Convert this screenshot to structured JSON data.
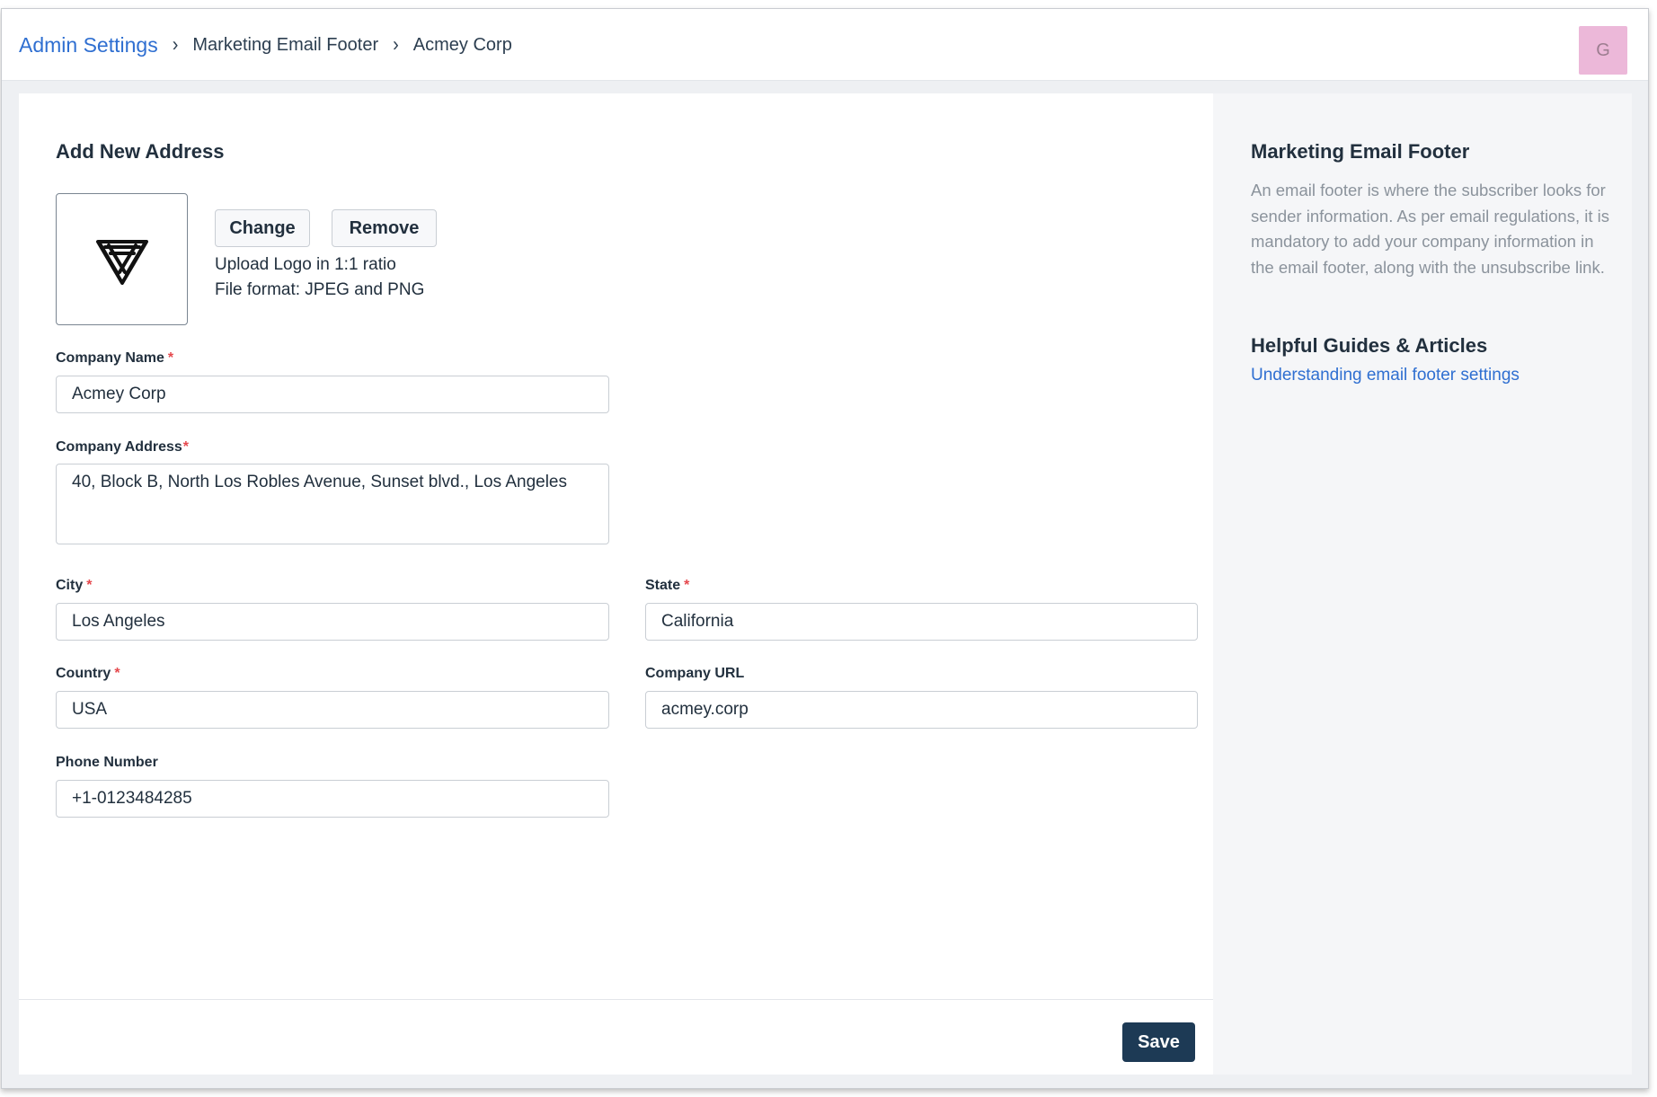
{
  "breadcrumb": {
    "root": "Admin Settings",
    "separator": "›",
    "items": [
      "Marketing Email Footer",
      "Acmey Corp"
    ]
  },
  "user": {
    "avatar_initial": "G",
    "avatar_color": "#ecb8d9"
  },
  "form": {
    "title": "Add New Address",
    "logo": {
      "icon": "company-logo-icon",
      "change_label": "Change",
      "remove_label": "Remove",
      "hint_ratio": "Upload Logo in 1:1 ratio",
      "hint_format": "File format: JPEG and PNG"
    },
    "required_marker": "*",
    "fields": {
      "company_name": {
        "label": "Company Name",
        "value": "Acmey Corp",
        "required": true
      },
      "company_address": {
        "label": "Company Address",
        "value": "40, Block B, North Los Robles Avenue, Sunset blvd., Los Angeles",
        "required": true
      },
      "city": {
        "label": "City",
        "value": "Los Angeles",
        "required": true
      },
      "state": {
        "label": "State",
        "value": "California",
        "required": true
      },
      "country": {
        "label": "Country",
        "value": "USA",
        "required": true
      },
      "company_url": {
        "label": "Company URL",
        "value": "acmey.corp",
        "required": false
      },
      "phone_number": {
        "label": "Phone Number",
        "value": "+1-0123484285",
        "required": false
      }
    },
    "save_label": "Save"
  },
  "side_panel": {
    "title": "Marketing Email Footer",
    "description": "An email footer is where the subscriber looks for sender information. As per email regulations, it is mandatory to add your company information in the email footer, along with the unsubscribe link.",
    "guides_title": "Helpful Guides & Articles",
    "guide_link": "Understanding email footer settings"
  },
  "colors": {
    "accent_link": "#2f6fd1",
    "primary_button": "#1d3a55",
    "required": "#e5484d"
  }
}
